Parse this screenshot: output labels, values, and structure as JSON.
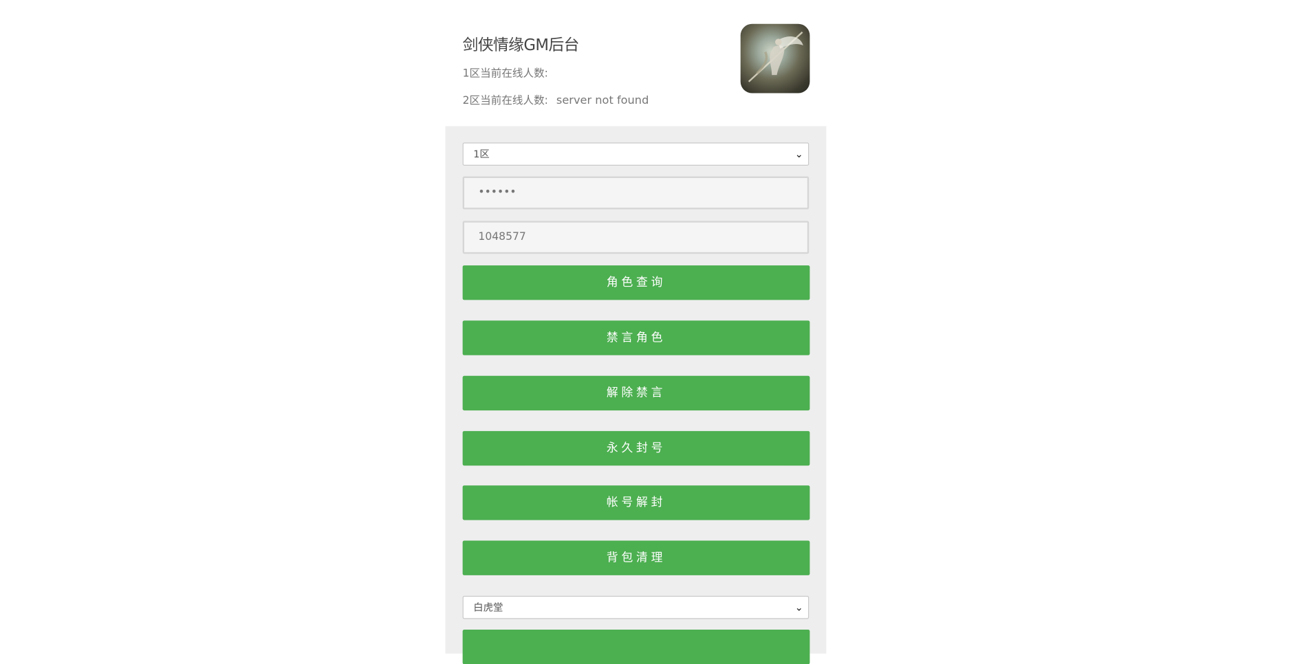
{
  "header": {
    "title": "剑侠情缘GM后台",
    "online_1_label": "1区当前在线人数:",
    "online_1_value": "",
    "online_2_label": "2区当前在线人数:",
    "online_2_value": "server not found"
  },
  "form": {
    "server_select": "1区",
    "password_value": "••••••",
    "role_id_value": "1048577",
    "buttons": [
      "角色查询",
      "禁言角色",
      "解除禁言",
      "永久封号",
      "帐号解封",
      "背包清理"
    ],
    "faction_select": "白虎堂"
  },
  "colors": {
    "button_green": "#4caf50",
    "panel_gray": "#eeeeee"
  }
}
